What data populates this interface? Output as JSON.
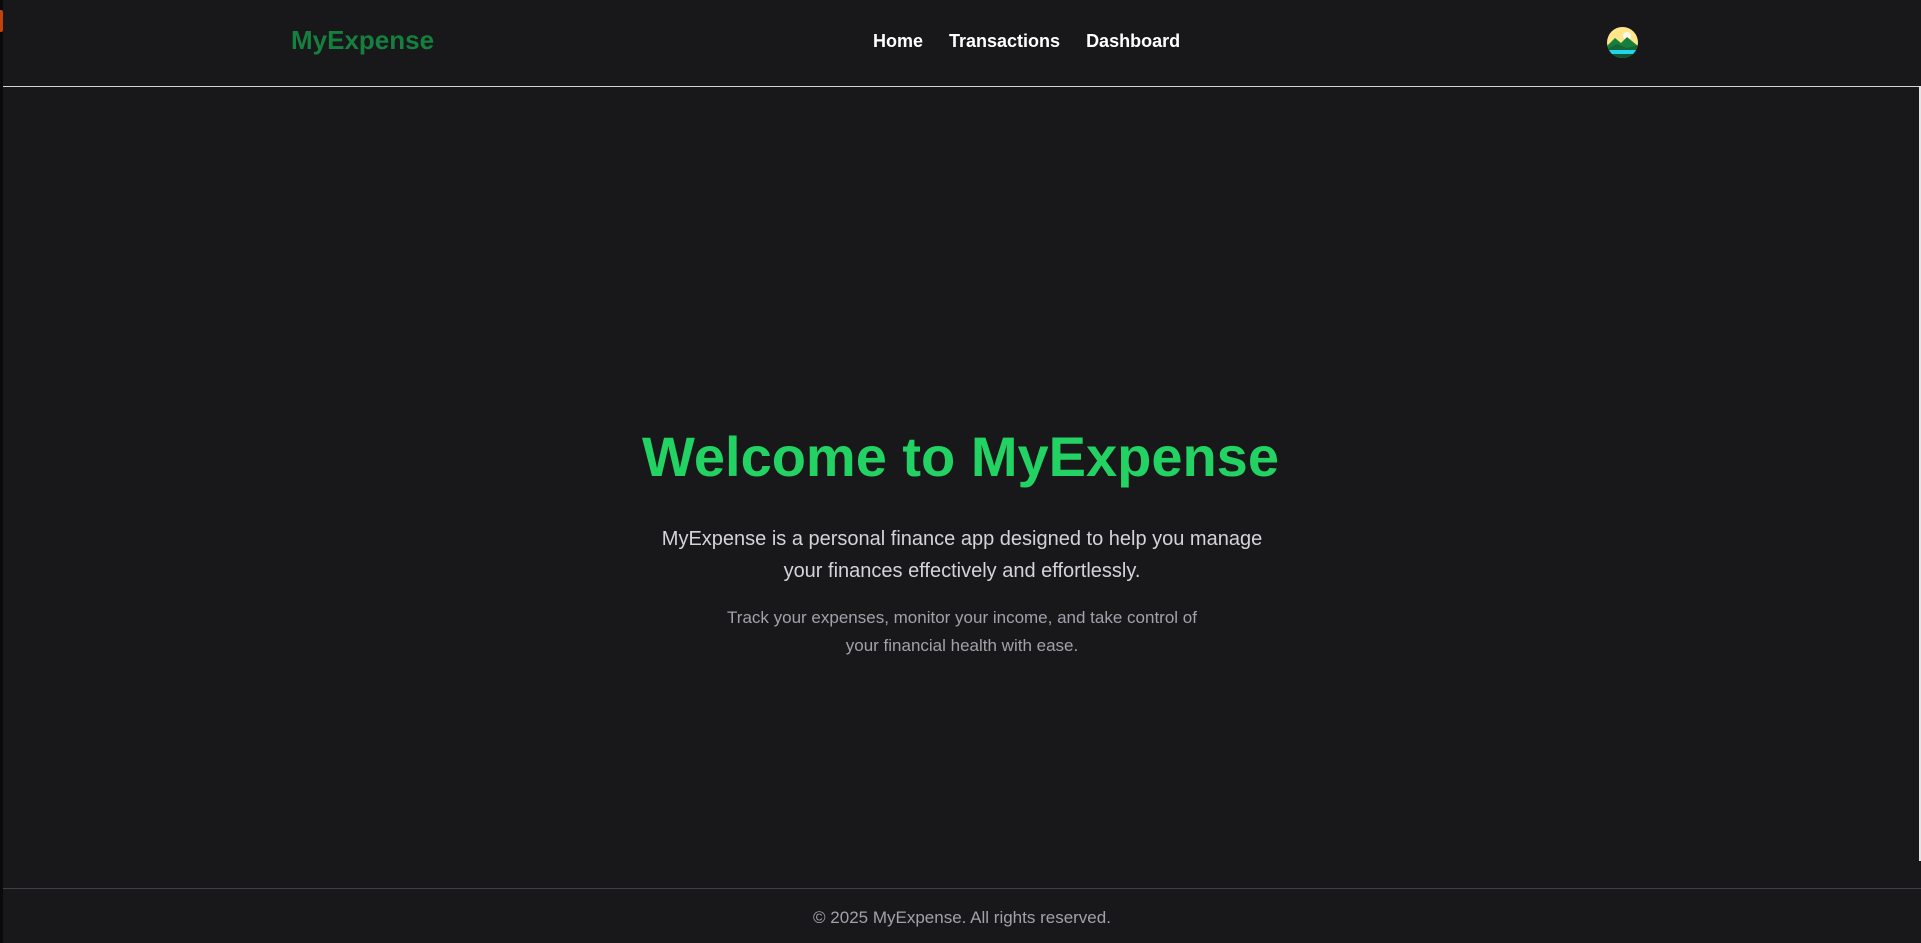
{
  "navbar": {
    "brand": "MyExpense",
    "links": [
      {
        "label": "Home"
      },
      {
        "label": "Transactions"
      },
      {
        "label": "Dashboard"
      }
    ],
    "avatar_icon": "landscape-avatar-icon"
  },
  "hero": {
    "title": "Welcome to MyExpense",
    "lead": "MyExpense is a personal finance app designed to help you manage your finances effectively and effortlessly.",
    "sub": "Track your expenses, monitor your income, and take control of your financial health with ease."
  },
  "footer": {
    "copyright": "© 2025 MyExpense. All rights reserved."
  },
  "colors": {
    "background": "#18181b",
    "brand": "#15803d",
    "accent": "#22d364",
    "nav_text": "#ffffff"
  }
}
